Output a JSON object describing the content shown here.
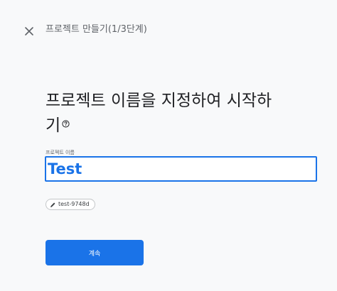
{
  "header": {
    "title": "프로젝트 만들기(1/3단계)",
    "close_icon": "close-icon"
  },
  "main": {
    "heading": "프로젝트 이름을 지정하여 시작하기",
    "help_icon": "help-circle-icon",
    "field_label": "프로젝트 이름",
    "project_name_value": "Test",
    "project_id_chip": {
      "icon": "pencil-icon",
      "text": "test-9748d"
    },
    "continue_label": "계속"
  },
  "colors": {
    "accent": "#1a73e8",
    "background": "#f8f9fa",
    "text": "#202124",
    "muted_text": "#5f6368"
  }
}
